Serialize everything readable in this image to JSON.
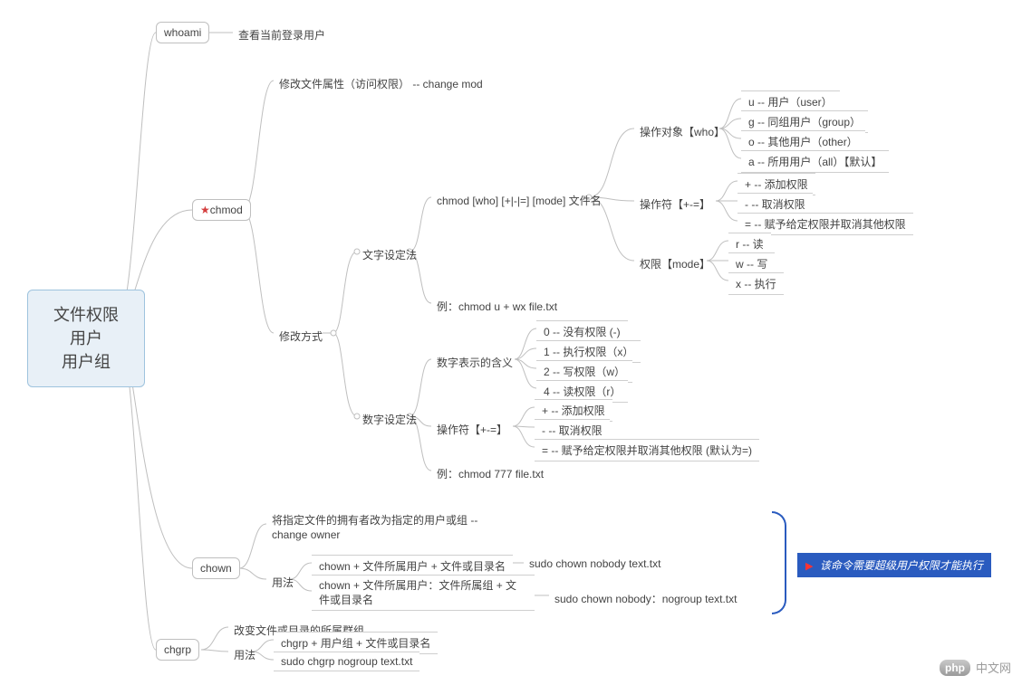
{
  "root": {
    "title_l1": "文件权限",
    "title_l2": "用户",
    "title_l3": "用户组"
  },
  "whoami": {
    "label": "whoami",
    "desc": "查看当前登录用户"
  },
  "chmod": {
    "label": "chmod",
    "desc": "修改文件属性（访问权限） -- change mod",
    "modify_label": "修改方式",
    "text": {
      "label": "文字设定法",
      "syntax": "chmod [who] [+|-|=] [mode] 文件名",
      "example": "例：chmod u + wx file.txt",
      "who": {
        "label": "操作对象【who】",
        "items": {
          "u": "u -- 用户（user）",
          "g": "g -- 同组用户（group）",
          "o": "o -- 其他用户（other）",
          "a": "a -- 所用用户（all）【默认】"
        }
      },
      "op": {
        "label": "操作符【+-=】",
        "items": {
          "plus": "+ -- 添加权限",
          "minus": "- -- 取消权限",
          "eq": "= -- 赋予给定权限并取消其他权限"
        }
      },
      "mode": {
        "label": "权限【mode】",
        "items": {
          "r": "r -- 读",
          "w": "w -- 写",
          "x": "x -- 执行"
        }
      }
    },
    "num": {
      "label": "数字设定法",
      "digits_label": "数字表示的含义",
      "digits": {
        "d0": "0 -- 没有权限 (-)",
        "d1": "1 -- 执行权限（x）",
        "d2": "2 -- 写权限（w）",
        "d4": "4 -- 读权限（r）"
      },
      "op": {
        "label": "操作符【+-=】",
        "items": {
          "plus": "+ -- 添加权限",
          "minus": "- -- 取消权限",
          "eq": "= -- 赋予给定权限并取消其他权限 (默认为=)"
        }
      },
      "example": "例：chmod 777 file.txt"
    }
  },
  "chown": {
    "label": "chown",
    "desc": "将指定文件的拥有者改为指定的用户或组 -- change owner",
    "usage_label": "用法",
    "u1_left": "chown + 文件所属用户 + 文件或目录名",
    "u1_right": "sudo chown nobody text.txt",
    "u2_left": "chown + 文件所属用户：文件所属组 + 文件或目录名",
    "u2_right": "sudo chown nobody：nogroup text.txt",
    "note": "该命令需要超级用户权限才能执行"
  },
  "chgrp": {
    "label": "chgrp",
    "desc": "改变文件或目录的所属群组",
    "usage_label": "用法",
    "u1": "chgrp + 用户组 + 文件或目录名",
    "u2": "sudo chgrp nogroup text.txt"
  },
  "watermark": {
    "icon": "php",
    "text": "中文网"
  }
}
